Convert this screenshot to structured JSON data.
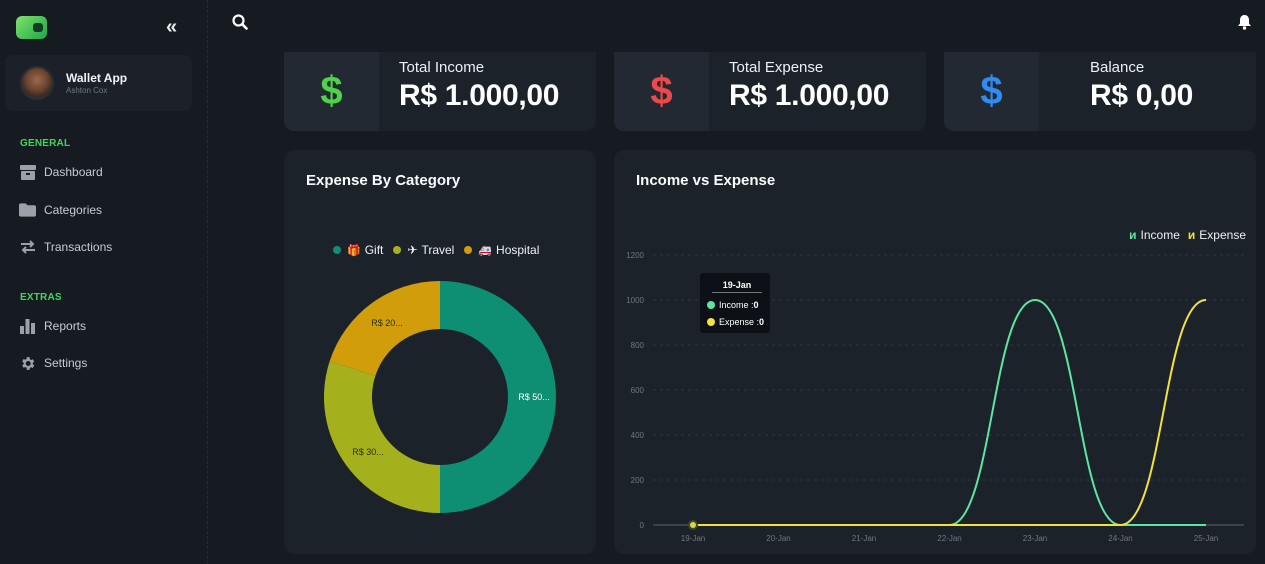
{
  "sidebar": {
    "profile": {
      "name": "Wallet App",
      "subtitle": "Ashton Cox"
    },
    "general_label": "GENERAL",
    "general_items": [
      {
        "label": "Dashboard",
        "icon": "box-icon"
      },
      {
        "label": "Categories",
        "icon": "folder-icon"
      },
      {
        "label": "Transactions",
        "icon": "arrows-icon"
      }
    ],
    "extras_label": "EXTRAS",
    "extras_items": [
      {
        "label": "Reports",
        "icon": "bar-chart-icon"
      },
      {
        "label": "Settings",
        "icon": "gear-icon"
      }
    ]
  },
  "stats": {
    "income": {
      "label": "Total Income",
      "value": "R$ 1.000,00",
      "symbol": "$",
      "color": "#4fd34a"
    },
    "expense": {
      "label": "Total Expense",
      "value": "R$ 1.000,00",
      "symbol": "$",
      "color": "#ef4848"
    },
    "balance": {
      "label": "Balance",
      "value": "R$ 0,00",
      "symbol": "$",
      "color": "#2f8cf2"
    }
  },
  "expense_panel": {
    "title": "Expense By Category",
    "legend": [
      {
        "label": "Gift",
        "emoji": "🎁",
        "color": "#0e8e72"
      },
      {
        "label": "Travel",
        "emoji": "✈",
        "color": "#a4b11c"
      },
      {
        "label": "Hospital",
        "emoji": "🚑",
        "color": "#d19d0a"
      }
    ],
    "slice_labels": [
      "R$ 50...",
      "R$ 30...",
      "R$ 20..."
    ]
  },
  "income_panel": {
    "title": "Income vs Expense",
    "legend": [
      {
        "label": "Income",
        "color": "#5ee6a0"
      },
      {
        "label": "Expense",
        "color": "#f2e33a"
      }
    ],
    "tooltip": {
      "title": "19-Jan",
      "income_label": "Income : ",
      "income_value": "0",
      "expense_label": "Expense : ",
      "expense_value": "0"
    }
  },
  "chart_data": [
    {
      "type": "pie",
      "categories": [
        "Gift",
        "Travel",
        "Hospital"
      ],
      "values": [
        50,
        30,
        20
      ],
      "colors": [
        "#0e8e72",
        "#a4b11c",
        "#d19d0a"
      ]
    },
    {
      "type": "line",
      "categories": [
        "19-Jan",
        "20-Jan",
        "21-Jan",
        "22-Jan",
        "23-Jan",
        "24-Jan",
        "25-Jan"
      ],
      "series": [
        {
          "name": "Income",
          "values": [
            0,
            0,
            0,
            0,
            1000,
            0,
            0
          ],
          "color": "#5ee6a0"
        },
        {
          "name": "Expense",
          "values": [
            0,
            0,
            0,
            0,
            0,
            0,
            1000
          ],
          "color": "#f2e33a"
        }
      ],
      "yticks": [
        0,
        200,
        400,
        600,
        800,
        1000,
        1200
      ],
      "ylim": [
        0,
        1200
      ],
      "grid": true,
      "legend": "top-right"
    }
  ]
}
